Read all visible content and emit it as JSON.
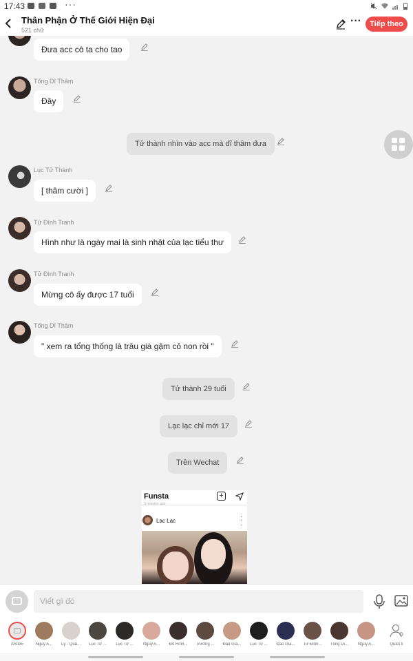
{
  "status_bar": {
    "time": "17:43",
    "dots": "···"
  },
  "header": {
    "title": "Thân Phận Ở Thế Giới Hiện Đại",
    "subtitle": "521 chữ",
    "next_label": "Tiếp theo"
  },
  "messages": [
    {
      "type": "character",
      "name": "",
      "text": "Đưa acc cô ta cho tao"
    },
    {
      "type": "character",
      "name": "Tống Dĩ Thâm",
      "text": "Đây"
    },
    {
      "type": "narration",
      "text": "Tử thành nhìn vào acc mà dĩ thâm đưa"
    },
    {
      "type": "character",
      "name": "Lục Tử Thành",
      "text": "[ thâm cười ]"
    },
    {
      "type": "character",
      "name": "Tử Đình Tranh",
      "text": "Hình như là ngày mai là sinh nhật của lạc tiểu thư"
    },
    {
      "type": "character",
      "name": "Tử Đình Tranh",
      "text": "Mừng cô ấy được 17 tuổi"
    },
    {
      "type": "character",
      "name": "Tống Dĩ Thâm",
      "text": "\" xem ra tổng thống là trâu già gặm cỏ non rồi \""
    },
    {
      "type": "narration",
      "text": "Tử thành 29 tuổi"
    },
    {
      "type": "narration",
      "text": "Lạc lạc chỉ mới 17"
    },
    {
      "type": "narration",
      "text": "Trên Wechat"
    }
  ],
  "image_preview": {
    "app_title": "Funsta",
    "username": "Lạc Lạc",
    "timestamp": "3 minutes ago"
  },
  "input": {
    "placeholder": "Viết gì đó"
  },
  "characters": [
    {
      "label": "ASIDE",
      "color": "#e8e8e8"
    },
    {
      "label": "Nguy A...",
      "color": "#9b7a5e"
    },
    {
      "label": "Lý - Quả...",
      "color": "#d9d1cc"
    },
    {
      "label": "Lục Tử ...",
      "color": "#4a4640"
    },
    {
      "label": "Lục Tử ...",
      "color": "#2c2a28"
    },
    {
      "label": "Nguy A...",
      "color": "#d7a99a"
    },
    {
      "label": "Đô Hình...",
      "color": "#3b2f2d"
    },
    {
      "label": "Trường ...",
      "color": "#5d4a40"
    },
    {
      "label": "Đào Gia...",
      "color": "#c79a86"
    },
    {
      "label": "Lục Tử ...",
      "color": "#1e1e1e"
    },
    {
      "label": "Đào Gia...",
      "color": "#2d2f52"
    },
    {
      "label": "Tử Đình...",
      "color": "#6a5248"
    },
    {
      "label": "Tống Dĩ...",
      "color": "#4b3530"
    },
    {
      "label": "Nguy A...",
      "color": "#c79584"
    },
    {
      "label": "Quản lí",
      "color": "#ffffff"
    }
  ],
  "colors": {
    "accent": "#ee4b4b",
    "bubble": "#ffffff",
    "narration": "#e2e2e2",
    "background": "#f2f2f2"
  }
}
